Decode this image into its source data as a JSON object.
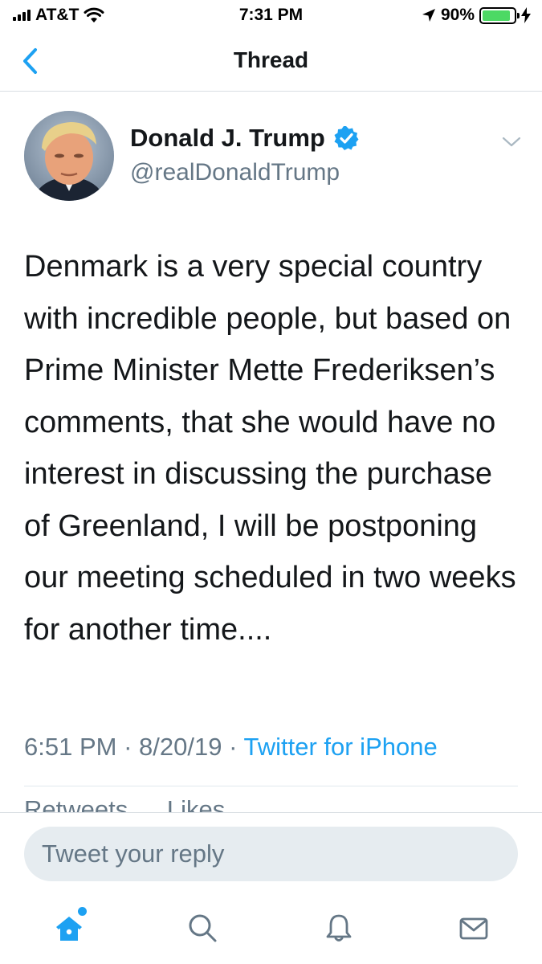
{
  "status_bar": {
    "carrier": "AT&T",
    "time": "7:31 PM",
    "battery_percent": "90%",
    "battery_level": 0.9,
    "icons": [
      "signal-icon",
      "wifi-icon",
      "location-icon",
      "battery-icon",
      "charging-icon"
    ]
  },
  "nav": {
    "title": "Thread",
    "back_icon": "chevron-left-icon"
  },
  "tweet": {
    "author_name": "Donald J. Trump",
    "handle": "@realDonaldTrump",
    "verified": true,
    "text": "Denmark is a very special country with incredible people, but based on Prime Minister Mette Frederiksen’s comments, that she would have no interest in discussing the purchase of Greenland, I will be postponing our meeting scheduled in two weeks for another time....",
    "time": "6:51 PM",
    "date": "8/20/19",
    "separator": "·",
    "source": "Twitter for iPhone",
    "retweets_label": "Retweets",
    "likes_label": "Likes"
  },
  "reply": {
    "placeholder": "Tweet your reply"
  },
  "tabs": [
    {
      "name": "home",
      "icon": "home-icon",
      "active": true,
      "has_notification_dot": true
    },
    {
      "name": "search",
      "icon": "search-icon",
      "active": false
    },
    {
      "name": "notifications",
      "icon": "bell-icon",
      "active": false
    },
    {
      "name": "messages",
      "icon": "mail-icon",
      "active": false
    }
  ],
  "colors": {
    "accent": "#1da1f2",
    "text_primary": "#14171a",
    "text_secondary": "#657786",
    "battery_green": "#4cd964",
    "reply_bg": "#e6ecf0"
  }
}
